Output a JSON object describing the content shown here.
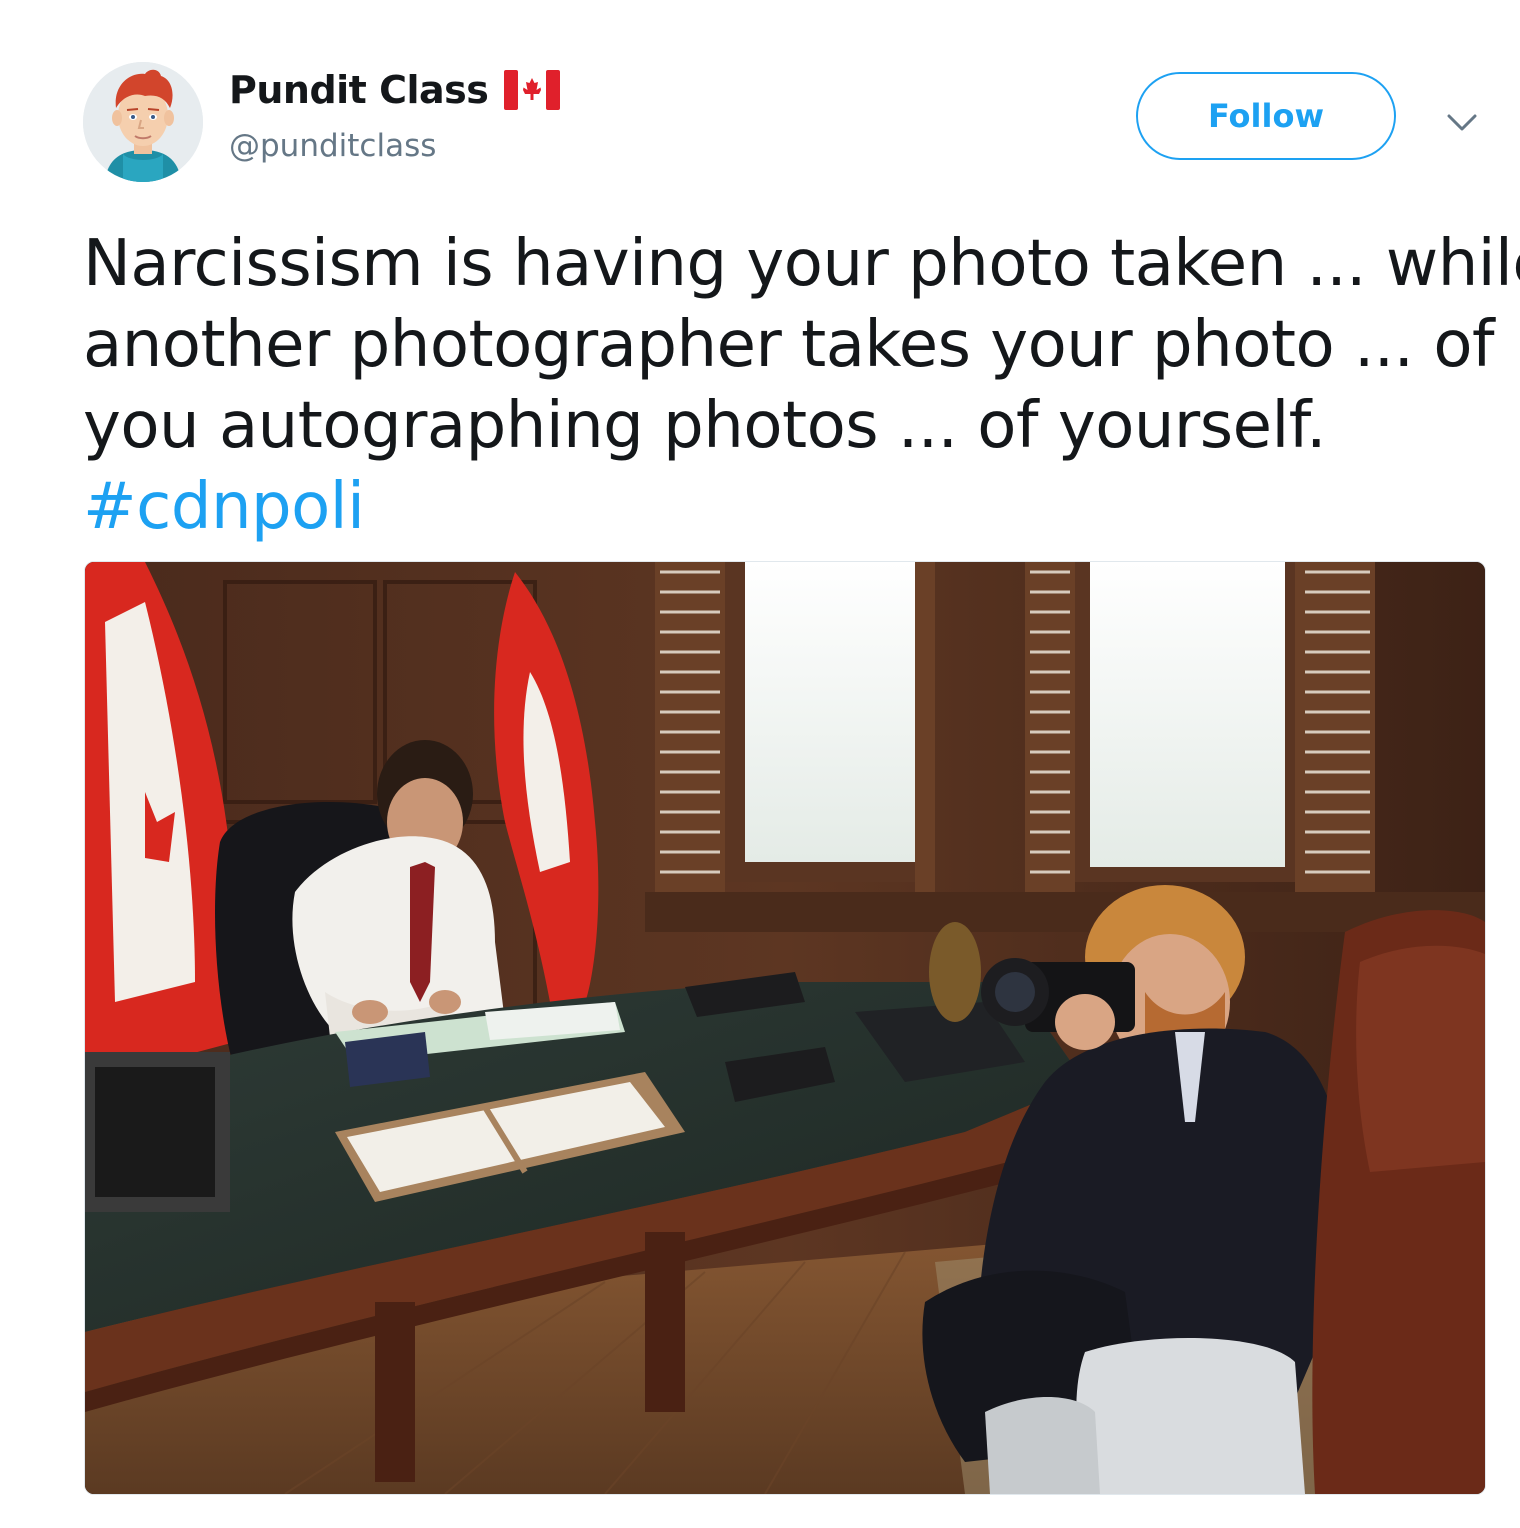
{
  "author": {
    "name": "Pundit Class",
    "handle": "@punditclass",
    "avatar_icon": "cartoon-avatar-icon",
    "flag_icon": "canada-flag-icon"
  },
  "actions": {
    "follow_label": "Follow",
    "more_icon": "chevron-down-icon"
  },
  "tweet": {
    "lines": [
      "Narcissism is having your photo taken ... while",
      "another photographer takes your photo ... of",
      "you autographing photos ... of yourself."
    ],
    "hashtag": "#cdnpoli"
  },
  "colors": {
    "accent": "#1da1f2",
    "text": "#14171a",
    "secondary_text": "#657786",
    "flag_red": "#e0202b"
  }
}
